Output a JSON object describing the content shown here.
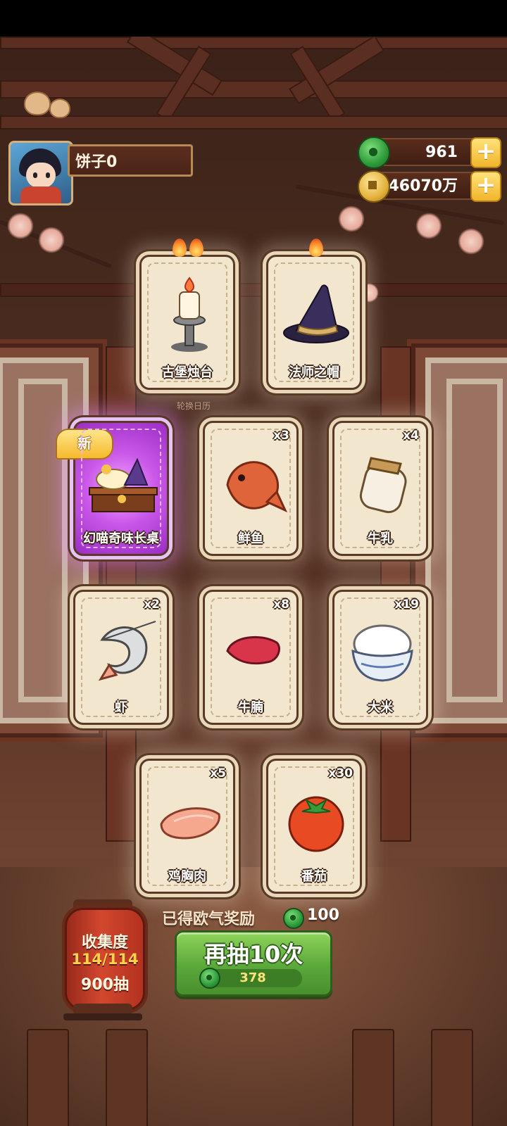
{
  "player": {
    "name": "饼子0"
  },
  "currencies": [
    {
      "icon": "jade-icon",
      "value": "961"
    },
    {
      "icon": "coin-icon",
      "value": "46070万"
    }
  ],
  "calendar_label": "轮换日历",
  "cards": [
    {
      "name": "古堡烛台",
      "count": "",
      "flames": 2,
      "icon": "candlestick-icon"
    },
    {
      "name": "法师之帽",
      "count": "",
      "flames": 1,
      "icon": "wizard-hat-icon"
    },
    {
      "name": "幻喵奇味长桌",
      "count": "",
      "badge": "新",
      "icon": "feast-table-icon",
      "special": true
    },
    {
      "name": "鲜鱼",
      "count": "x3",
      "icon": "fish-icon"
    },
    {
      "name": "牛乳",
      "count": "x4",
      "icon": "milk-jar-icon"
    },
    {
      "name": "虾",
      "count": "x2",
      "icon": "shrimp-icon"
    },
    {
      "name": "牛腩",
      "count": "x8",
      "icon": "beef-icon"
    },
    {
      "name": "大米",
      "count": "x19",
      "icon": "rice-bowl-icon"
    },
    {
      "name": "鸡胸肉",
      "count": "x5",
      "icon": "chicken-breast-icon"
    },
    {
      "name": "番茄",
      "count": "x30",
      "icon": "tomato-icon"
    }
  ],
  "bonus": {
    "label": "已得欧气奖励",
    "value": "100",
    "icon": "jade-icon"
  },
  "draw_button": {
    "label": "再抽10次",
    "cost": "378",
    "icon": "jade-icon"
  },
  "collection": {
    "title": "收集度",
    "progress": "114/114",
    "draws": "900抽"
  },
  "colors": {
    "card_bg": "#f3e6cf",
    "special_glow": "#c957e8",
    "button_green": "#5aa83a",
    "lantern_red": "#d2472e"
  }
}
